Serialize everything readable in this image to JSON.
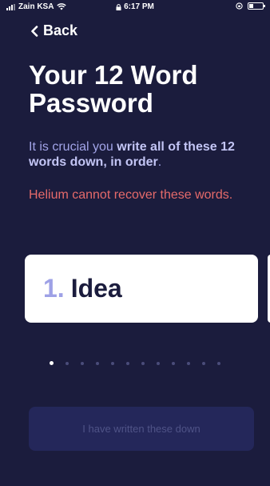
{
  "status_bar": {
    "carrier": "Zain KSA",
    "time": "6:17 PM"
  },
  "nav": {
    "back_label": "Back"
  },
  "title": "Your 12 Word Password",
  "description": {
    "prefix": "It is crucial you ",
    "emphasis": "write all of these 12 words down, in order",
    "suffix": "."
  },
  "warning": "Helium cannot recover these words.",
  "word_card": {
    "number": "1.",
    "word": "Idea"
  },
  "pagination": {
    "total": 12,
    "current": 1
  },
  "confirm_button": {
    "label": "I have written these down",
    "enabled": false
  },
  "colors": {
    "background": "#1b1c3d",
    "description": "#a2a4e8",
    "warning": "#e56a6a",
    "word_number": "#9ea1e6",
    "button_bg": "#24275a",
    "button_text": "#4f5387"
  }
}
